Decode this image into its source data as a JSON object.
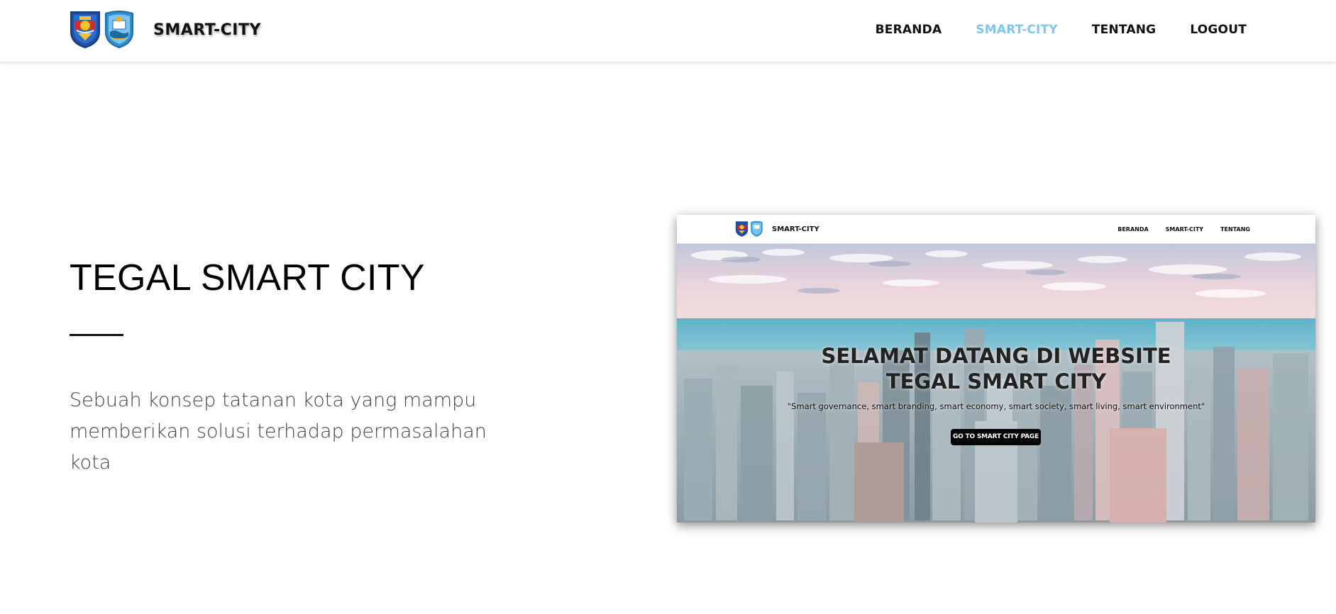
{
  "navbar": {
    "brand_title": "SMART-CITY",
    "links": [
      "BERANDA",
      "SMART-CITY",
      "TENTANG",
      "LOGOUT"
    ],
    "active_link": "SMART-CITY"
  },
  "hero": {
    "title": "TEGAL SMART CITY",
    "description": "Sebuah konsep tatanan kota yang mampu memberikan solusi terhadap permasalahan kota"
  },
  "preview": {
    "brand_title": "SMART-CITY",
    "links": [
      "BERANDA",
      "SMART-CITY",
      "TENTANG"
    ],
    "welcome_line1": "SELAMAT DATANG DI WEBSITE",
    "welcome_line2": "TEGAL SMART CITY",
    "subtitle": "\"Smart governance, smart branding, smart economy, smart society, smart living, smart environment\"",
    "button_label": "GO TO SMART CITY PAGE"
  },
  "colors": {
    "active_link": "#7fc6ee",
    "text": "#111111",
    "crest_blue": "#2a56a8",
    "crest_gold": "#e6b422",
    "crest_teal": "#3a9ad6"
  },
  "icons": [
    "tegal-city-crest-icon",
    "central-java-crest-icon"
  ]
}
